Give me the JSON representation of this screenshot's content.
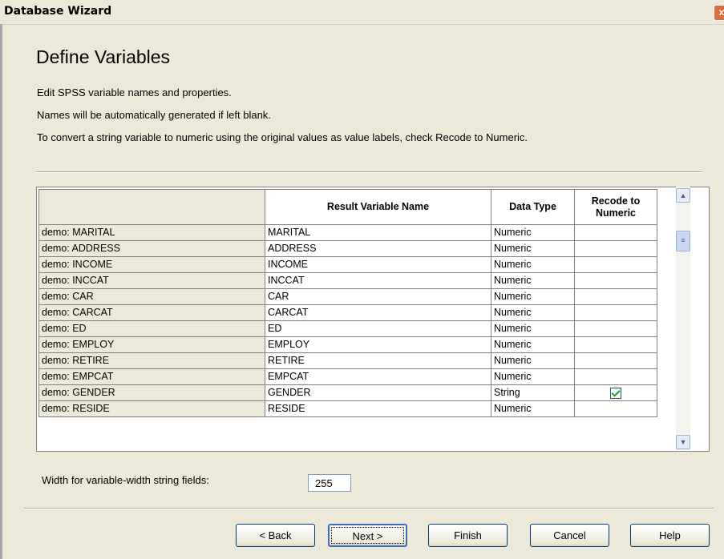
{
  "window": {
    "title": "Database Wizard",
    "close_glyph": "x"
  },
  "page": {
    "heading": "Define Variables",
    "lines": [
      "Edit SPSS variable names and properties.",
      "Names will be automatically generated if left blank.",
      "To convert a string variable to numeric using the original values as value labels, check Recode to Numeric."
    ]
  },
  "grid": {
    "columns": [
      "",
      "Result Variable Name",
      "Data Type",
      "Recode to Numeric"
    ],
    "rows": [
      {
        "source": "demo: MARITAL",
        "name": "MARITAL",
        "type": "Numeric",
        "recode": false,
        "show_checkbox": false
      },
      {
        "source": "demo: ADDRESS",
        "name": "ADDRESS",
        "type": "Numeric",
        "recode": false,
        "show_checkbox": false
      },
      {
        "source": "demo: INCOME",
        "name": "INCOME",
        "type": "Numeric",
        "recode": false,
        "show_checkbox": false
      },
      {
        "source": "demo: INCCAT",
        "name": "INCCAT",
        "type": "Numeric",
        "recode": false,
        "show_checkbox": false
      },
      {
        "source": "demo: CAR",
        "name": "CAR",
        "type": "Numeric",
        "recode": false,
        "show_checkbox": false
      },
      {
        "source": "demo: CARCAT",
        "name": "CARCAT",
        "type": "Numeric",
        "recode": false,
        "show_checkbox": false
      },
      {
        "source": "demo: ED",
        "name": "ED",
        "type": "Numeric",
        "recode": false,
        "show_checkbox": false
      },
      {
        "source": "demo: EMPLOY",
        "name": "EMPLOY",
        "type": "Numeric",
        "recode": false,
        "show_checkbox": false
      },
      {
        "source": "demo: RETIRE",
        "name": "RETIRE",
        "type": "Numeric",
        "recode": false,
        "show_checkbox": false
      },
      {
        "source": "demo: EMPCAT",
        "name": "EMPCAT",
        "type": "Numeric",
        "recode": false,
        "show_checkbox": false
      },
      {
        "source": "demo: GENDER",
        "name": "GENDER",
        "type": "String",
        "recode": true,
        "show_checkbox": true
      },
      {
        "source": "demo: RESIDE",
        "name": "RESIDE",
        "type": "Numeric",
        "recode": false,
        "show_checkbox": false
      }
    ]
  },
  "scrollbar": {
    "up_icon": "chevron-up-icon",
    "down_icon": "chevron-down-icon"
  },
  "width_field": {
    "label": "Width for variable-width string fields:",
    "value": "255"
  },
  "buttons": {
    "back": "< Back",
    "next": "Next >",
    "finish": "Finish",
    "cancel": "Cancel",
    "help": "Help"
  }
}
